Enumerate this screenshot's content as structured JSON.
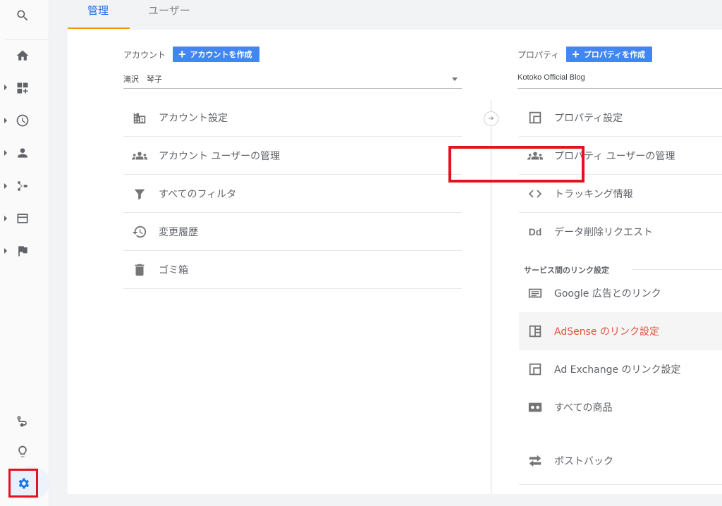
{
  "tabs": [
    {
      "label": "管理",
      "active": true
    },
    {
      "label": "ユーザー",
      "active": false
    }
  ],
  "sidebar": {
    "top_icons": [
      "search-icon",
      "home-icon",
      "dashboard-icon",
      "clock-icon",
      "person-icon",
      "branch-icon",
      "display-icon",
      "flag-icon"
    ],
    "bottom_icons": [
      "route-icon",
      "lightbulb-icon",
      "gear-icon"
    ]
  },
  "account": {
    "header_label": "アカウント",
    "create_button": "アカウントを作成",
    "selected": "滝沢　琴子",
    "items": [
      {
        "label": "アカウント設定",
        "icon": "building-icon"
      },
      {
        "label": "アカウント ユーザーの管理",
        "icon": "people-icon"
      },
      {
        "label": "すべてのフィルタ",
        "icon": "filter-icon"
      },
      {
        "label": "変更履歴",
        "icon": "history-icon"
      },
      {
        "label": "ゴミ箱",
        "icon": "trash-icon"
      }
    ]
  },
  "property": {
    "header_label": "プロパティ",
    "create_button": "プロパティを作成",
    "selected": "Kotoko Official Blog",
    "items": [
      {
        "label": "プロパティ設定",
        "icon": "window-icon"
      },
      {
        "label": "プロパティ ユーザーの管理",
        "icon": "people-icon"
      },
      {
        "label": "トラッキング情報",
        "icon": "code-icon"
      },
      {
        "label": "データ削除リクエスト",
        "icon": "Dd"
      }
    ],
    "link_section_title": "サービス間のリンク設定",
    "link_items": [
      {
        "label": "Google 広告とのリンク",
        "icon": "ads-icon"
      },
      {
        "label": "AdSense のリンク設定",
        "icon": "adsense-icon",
        "highlight": true
      },
      {
        "label": "Ad Exchange のリンク設定",
        "icon": "window-icon"
      },
      {
        "label": "すべての商品",
        "icon": "products-icon"
      },
      {
        "label": "ポストバック",
        "icon": "postback-icon"
      }
    ]
  },
  "colors": {
    "accent": "#1a73e8",
    "tab_underline": "#f29900",
    "highlight_text": "#e25241",
    "annotation_red": "#e0141e"
  }
}
